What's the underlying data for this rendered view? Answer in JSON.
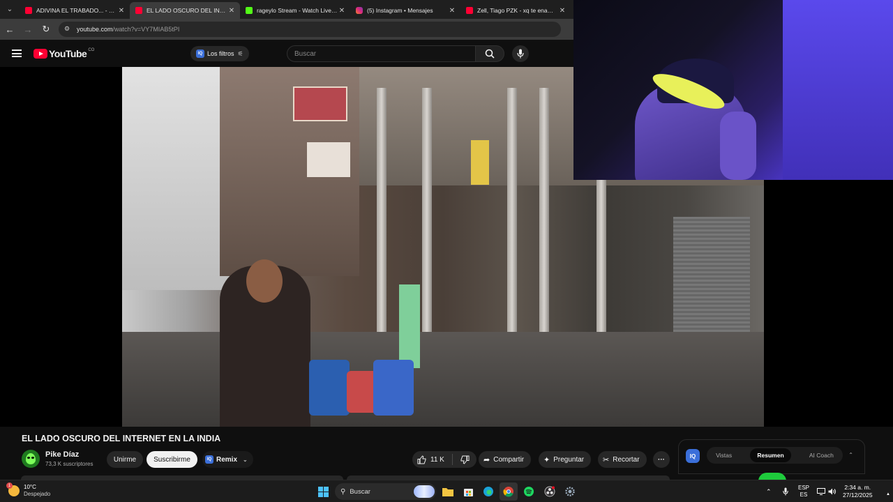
{
  "browser": {
    "tabs": [
      {
        "title": "ADIVINA EL TRABADO... - YouTube",
        "favicon": "youtube-icon",
        "active": false
      },
      {
        "title": "EL LADO OSCURO DEL INTERNET",
        "favicon": "youtube-icon",
        "active": true
      },
      {
        "title": "rageylo Stream - Watch Live on Kick",
        "favicon": "kick-icon",
        "active": false
      },
      {
        "title": "(5) Instagram • Mensajes",
        "favicon": "instagram-icon",
        "active": false
      },
      {
        "title": "Zell, Tiago PZK - xq te enamoraste",
        "favicon": "youtube-icon",
        "active": false
      }
    ],
    "address": {
      "domain": "youtube.com",
      "path": "/watch?v=VY7MIAB5tPI"
    }
  },
  "youtube": {
    "logo_text": "YouTube",
    "country_code": "CO",
    "filters_label": "Los filtros",
    "search_placeholder": "Buscar"
  },
  "video": {
    "title": "EL LADO OSCURO DEL INTERNET EN LA INDIA",
    "channel": {
      "name": "Pike Díaz",
      "subscribers": "73,3 K suscriptores"
    },
    "join_label": "Unirme",
    "subscribe_label": "Suscribirme",
    "remix_label": "Remix",
    "likes": "11 K",
    "share_label": "Compartir",
    "ask_label": "Preguntar",
    "clip_label": "Recortar"
  },
  "side_panel": {
    "badge": "IQ",
    "tabs": [
      "Vistas",
      "Resumen",
      "AI Coach"
    ],
    "active_tab": "Resumen"
  },
  "taskbar": {
    "weather": {
      "temp": "10°C",
      "condition": "Despejado",
      "badge": "1"
    },
    "search_label": "Buscar",
    "lang": {
      "line1": "ESP",
      "line2": "ES"
    },
    "clock": {
      "time": "2:34 a. m.",
      "date": "27/12/2025"
    }
  },
  "colors": {
    "youtube_red": "#ff0033",
    "bg": "#0f0f0f",
    "iq_blue": "#3b6fd9",
    "accent_green": "#1ecb3c"
  }
}
